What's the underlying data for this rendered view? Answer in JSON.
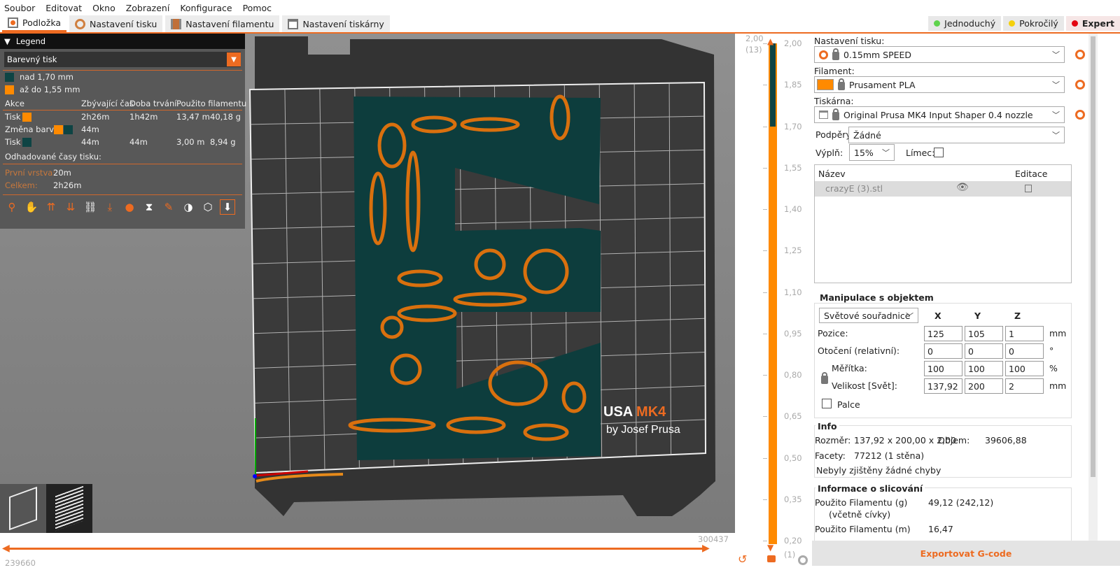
{
  "menu": [
    "Soubor",
    "Editovat",
    "Okno",
    "Zobrazení",
    "Konfigurace",
    "Pomoc"
  ],
  "tabs": [
    {
      "label": "Podložka",
      "icon": "plater-icon"
    },
    {
      "label": "Nastavení tisku",
      "icon": "gear-icon"
    },
    {
      "label": "Nastavení filamentu",
      "icon": "filament-icon"
    },
    {
      "label": "Nastavení tiskárny",
      "icon": "printer-icon"
    }
  ],
  "modes": [
    {
      "label": "Jednoduchý",
      "color": "#5fd34c"
    },
    {
      "label": "Pokročilý",
      "color": "#f5d00b"
    },
    {
      "label": "Expert",
      "color": "#e30613"
    }
  ],
  "legend": {
    "title": "Legend",
    "view_type": "Barevný tisk",
    "ranges": [
      {
        "label": "nad 1,70 mm",
        "color": "#0e4444"
      },
      {
        "label": "až do 1,55 mm",
        "color": "#ff8a00"
      }
    ],
    "headers": [
      "Akce",
      "Zbývající čas",
      "Doba trvání",
      "Použito filamentu"
    ],
    "rows": [
      {
        "action": "Tisk",
        "remaining": "2h26m",
        "duration": "1h42m",
        "length": "13,47 m",
        "weight": "40,18 g"
      },
      {
        "action": "Změna barvy",
        "remaining": "44m",
        "duration": "",
        "length": "",
        "weight": ""
      },
      {
        "action": "Tisk",
        "remaining": "44m",
        "duration": "44m",
        "length": "3,00 m",
        "weight": "8,94 g"
      }
    ],
    "estimated_title": "Odhadované časy tisku:",
    "first_layer_label": "První vrstva:",
    "first_layer": "20m",
    "total_label": "Celkem:",
    "total": "2h26m"
  },
  "bed_logo": {
    "brand": "USA",
    "model": "MK4",
    "by": "by Josef Prusa"
  },
  "hslider": {
    "max": "300437",
    "min": "239660"
  },
  "vslider": {
    "top_value": "2,00",
    "top_layer": "(13)",
    "bottom_value": "0,20",
    "bottom_layer": "(1)",
    "change_at": "1,70",
    "ticks": [
      "2,00",
      "1,85",
      "1,70",
      "1,55",
      "1,40",
      "1,25",
      "1,10",
      "0,95",
      "0,80",
      "0,65",
      "0,50",
      "0,35",
      "0,20"
    ],
    "upper_color": "#0e4444",
    "lower_color": "#ff8a00"
  },
  "sidebar": {
    "print_label": "Nastavení tisku:",
    "print_value": "0.15mm SPEED",
    "filament_label": "Filament:",
    "filament_value": "Prusament PLA",
    "filament_color": "#ff8a00",
    "printer_label": "Tiskárna:",
    "printer_value": "Original Prusa MK4 Input Shaper 0.4 nozzle",
    "supports_label": "Podpěry:",
    "supports_value": "Žádné",
    "infill_label": "Výplň:",
    "infill_value": "15%",
    "brim_label": "Límec:",
    "objects": {
      "col_name": "Název",
      "col_edit": "Editace",
      "items": [
        {
          "name": "crazyE (3).stl"
        }
      ]
    },
    "manip": {
      "title": "Manipulace s objektem",
      "coords": "Světové souřadnice",
      "axes": [
        "X",
        "Y",
        "Z"
      ],
      "rows": [
        {
          "label": "Pozice:",
          "values": [
            "125",
            "105",
            "1"
          ],
          "unit": "mm"
        },
        {
          "label": "Otočení (relativní):",
          "values": [
            "0",
            "0",
            "0"
          ],
          "unit": "°"
        },
        {
          "label": "Měřítka:",
          "values": [
            "100",
            "100",
            "100"
          ],
          "unit": "%"
        },
        {
          "label": "Velikost [Svět]:",
          "values": [
            "137,92",
            "200",
            "2"
          ],
          "unit": "mm"
        }
      ],
      "inches": "Palce"
    },
    "info": {
      "title": "Info",
      "size_label": "Rozměr:",
      "size": "137,92 x 200,00 x 2,00",
      "volume_label": "Objem:",
      "volume": "39606,88",
      "facets_label": "Facety:",
      "facets": "77212 (1 stěna)",
      "errors": "Nebyly zjištěny žádné chyby"
    },
    "slice": {
      "title": "Informace o slicování",
      "g_label": "Použito Filamentu (g)",
      "g_sub": "(včetně cívky)",
      "g_value": "49,12 (242,12)",
      "m_label": "Použito Filamentu (m)",
      "m_value": "16,47"
    },
    "export": "Exportovat G-code"
  }
}
